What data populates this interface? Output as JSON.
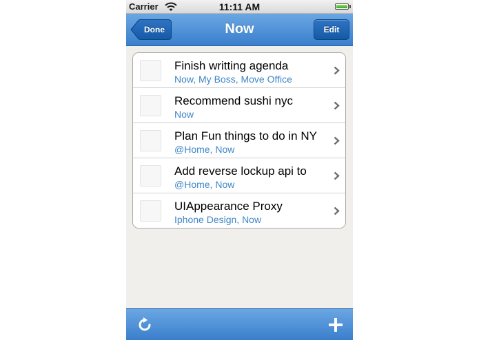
{
  "status_bar": {
    "carrier": "Carrier",
    "time": "11:11 AM",
    "battery_level": 1.0
  },
  "nav_bar": {
    "title": "Now",
    "back_label": "Done",
    "edit_label": "Edit"
  },
  "tasks": [
    {
      "title": "Finish writting agenda",
      "tags": "Now, My Boss, Move Office"
    },
    {
      "title": "Recommend sushi nyc",
      "tags": "Now"
    },
    {
      "title": "Plan Fun things to do in NY",
      "tags": "@Home, Now"
    },
    {
      "title": "Add reverse lockup api to",
      "tags": "@Home, Now"
    },
    {
      "title": "UIAppearance Proxy",
      "tags": "Iphone Design, Now"
    }
  ],
  "toolbar": {
    "left_icon": "refresh-icon",
    "right_icon": "plus-icon"
  },
  "colors": {
    "bar_blue": "#3a7fcc",
    "tag_blue": "#3f86c8",
    "background": "#f1efeb"
  }
}
